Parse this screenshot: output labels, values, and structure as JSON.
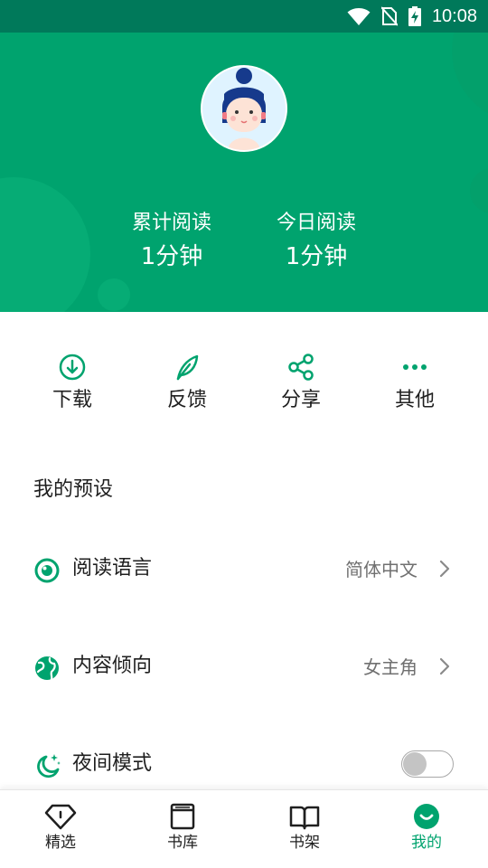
{
  "status_bar": {
    "time": "10:08"
  },
  "stats": {
    "total": {
      "label": "累计阅读",
      "value": "1分钟"
    },
    "today": {
      "label": "今日阅读",
      "value": "1分钟"
    }
  },
  "actions": [
    {
      "label": "下载",
      "icon": "download-icon"
    },
    {
      "label": "反馈",
      "icon": "feather-icon"
    },
    {
      "label": "分享",
      "icon": "share-icon"
    },
    {
      "label": "其他",
      "icon": "more-icon"
    }
  ],
  "presets": {
    "title": "我的预设",
    "items": [
      {
        "label": "阅读语言",
        "value": "简体中文",
        "icon": "eye-icon"
      },
      {
        "label": "内容倾向",
        "value": "女主角",
        "icon": "globe-icon"
      },
      {
        "label": "夜间模式",
        "icon": "moon-stars-icon",
        "toggle_on": false
      }
    ]
  },
  "tabs": [
    {
      "label": "精选",
      "icon": "diamond-icon",
      "active": false
    },
    {
      "label": "书库",
      "icon": "book-stack-icon",
      "active": false
    },
    {
      "label": "书架",
      "icon": "open-book-icon",
      "active": false
    },
    {
      "label": "我的",
      "icon": "smile-icon",
      "active": true
    }
  ],
  "colors": {
    "brand": "#00a36e",
    "status_bar": "#00795a",
    "text": "#1f1f1f",
    "secondary_text": "#707070",
    "toggle_off": "#c4c4c4"
  }
}
